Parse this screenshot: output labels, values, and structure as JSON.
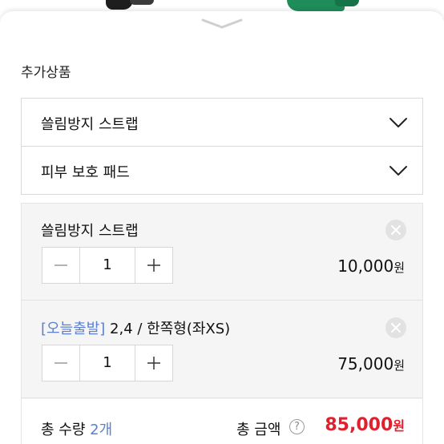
{
  "additional_products": {
    "title": "추가상품",
    "options": [
      {
        "label": "쓸림방지 스트랩"
      },
      {
        "label": "피부 보호 패드"
      }
    ]
  },
  "selected_items": [
    {
      "tag": "",
      "name": "쓸림방지 스트랩",
      "quantity": "1",
      "price": "10,000",
      "currency": "원"
    },
    {
      "tag": "[오늘출발]",
      "name": " 2,4 / 한쪽형(좌XS)",
      "quantity": "1",
      "price": "75,000",
      "currency": "원"
    }
  ],
  "summary": {
    "total_quantity_label": "총 수량 ",
    "total_quantity_value": "2개",
    "total_amount_label": "총 금액",
    "help_symbol": "?",
    "total_amount_value": "85,000",
    "currency": "원"
  },
  "icons": {
    "sheet_handle": "chevron-down-icon",
    "dropdown": "chevron-down-icon",
    "remove": "close-icon",
    "decrease": "minus-icon",
    "increase": "plus-icon",
    "help": "question-icon"
  },
  "colors": {
    "accent_blue": "#5b7fd1",
    "price_red": "#e0202c",
    "panel_bg": "#f5f5f5"
  }
}
